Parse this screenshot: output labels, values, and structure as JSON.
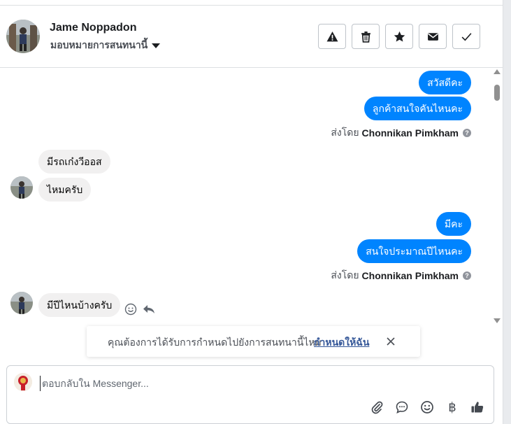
{
  "header": {
    "contact_name": "Jame Noppadon",
    "assign_label": "มอบหมายการสนทนานี้",
    "actions": [
      {
        "icon": "warning-icon"
      },
      {
        "icon": "trash-icon"
      },
      {
        "icon": "star-icon"
      },
      {
        "icon": "envelope-icon"
      },
      {
        "icon": "check-icon"
      }
    ]
  },
  "messages": {
    "out_1": "สวัสดีคะ",
    "out_2": "ลูกค้าสนใจคันไหนคะ",
    "in_1": "มีรถเก๋งวีออส",
    "in_2": "ไหมครับ",
    "out_3": "มีคะ",
    "out_4": "สนใจประมาณปีไหนคะ",
    "in_3": "มีปีไหนบ้างครับ"
  },
  "sent_by": {
    "prefix": "ส่งโดย",
    "agent": "Chonnikan Pimkham"
  },
  "banner": {
    "text": "คุณต้องการได้รับการกำหนดไปยังการสนทนานี้ไหม",
    "link": "กำหนดให้ฉัน"
  },
  "composer": {
    "placeholder": "ตอบกลับใน Messenger...",
    "value": "",
    "icons": [
      "paperclip-icon",
      "chat-bubble-icon",
      "emoji-icon",
      "baht-icon",
      "thumbs-up-icon"
    ]
  },
  "colors": {
    "outgoing_bubble": "#0084ff",
    "incoming_bubble": "#f1f0f0",
    "link": "#365899"
  }
}
